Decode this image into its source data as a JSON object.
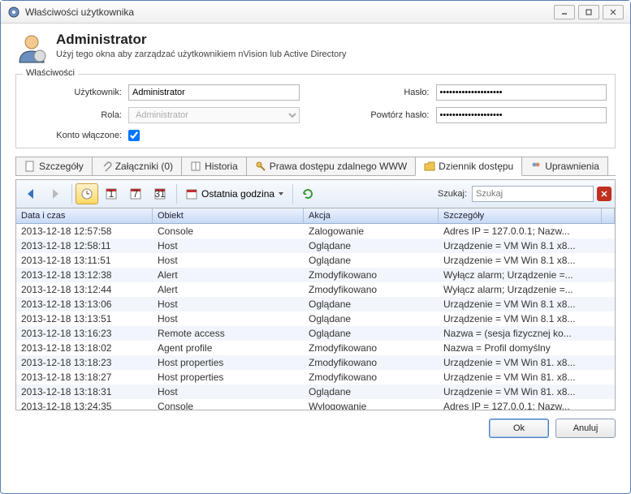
{
  "window": {
    "title": "Właściwości użytkownika"
  },
  "header": {
    "title": "Administrator",
    "subtitle": "Użyj tego okna aby zarządzać użytkownikiem nVision lub Active Directory"
  },
  "props": {
    "legend": "Właściwości",
    "user_label": "Użytkownik:",
    "user_value": "Administrator",
    "role_label": "Rola:",
    "role_value": "Administrator",
    "enabled_label": "Konto włączone:",
    "pass_label": "Hasło:",
    "pass_value": "********************",
    "pass2_label": "Powtórz hasło:",
    "pass2_value": "********************"
  },
  "tabs": [
    "Szczegóły",
    "Załączniki (0)",
    "Historia",
    "Prawa dostępu zdalnego WWW",
    "Dziennik dostępu",
    "Uprawnienia"
  ],
  "toolbar": {
    "range": "Ostatnia godzina",
    "search_label": "Szukaj:",
    "search_placeholder": "Szukaj"
  },
  "grid": {
    "cols": [
      "Data i czas",
      "Obiekt",
      "Akcja",
      "Szczegóły"
    ],
    "rows": [
      [
        "2013-12-18 12:57:58",
        "Console",
        "Zalogowanie",
        "Adres IP = 127.0.0.1; Nazw..."
      ],
      [
        "2013-12-18 12:58:11",
        "Host",
        "Oglądane",
        "Urządzenie = VM Win 8.1 x8..."
      ],
      [
        "2013-12-18 13:11:51",
        "Host",
        "Oglądane",
        "Urządzenie = VM Win 8.1 x8..."
      ],
      [
        "2013-12-18 13:12:38",
        "Alert",
        "Zmodyfikowano",
        "Wyłącz alarm; Urządzenie =..."
      ],
      [
        "2013-12-18 13:12:44",
        "Alert",
        "Zmodyfikowano",
        "Wyłącz alarm; Urządzenie =..."
      ],
      [
        "2013-12-18 13:13:06",
        "Host",
        "Oglądane",
        "Urządzenie = VM Win 8.1 x8..."
      ],
      [
        "2013-12-18 13:13:51",
        "Host",
        "Oglądane",
        "Urządzenie = VM Win 8.1 x8..."
      ],
      [
        "2013-12-18 13:16:23",
        "Remote access",
        "Oglądane",
        "Nazwa = (sesja fizycznej ko..."
      ],
      [
        "2013-12-18 13:18:02",
        "Agent profile",
        "Zmodyfikowano",
        "Nazwa = Profil domyślny"
      ],
      [
        "2013-12-18 13:18:23",
        "Host properties",
        "Zmodyfikowano",
        "Urządzenie = VM Win 81. x8..."
      ],
      [
        "2013-12-18 13:18:27",
        "Host properties",
        "Zmodyfikowano",
        "Urządzenie = VM Win 81. x8..."
      ],
      [
        "2013-12-18 13:18:31",
        "Host",
        "Oglądane",
        "Urządzenie = VM Win 81. x8..."
      ],
      [
        "2013-12-18 13:24:35",
        "Console",
        "Wylogowanie",
        "Adres IP = 127.0.0.1; Nazw..."
      ]
    ]
  },
  "buttons": {
    "ok": "Ok",
    "cancel": "Anuluj"
  }
}
